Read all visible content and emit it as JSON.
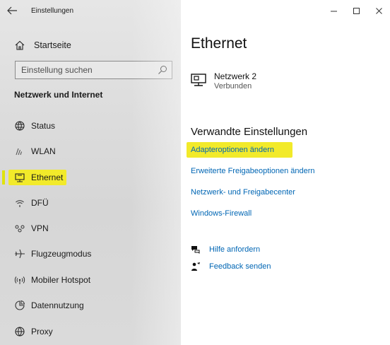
{
  "window": {
    "title": "Einstellungen"
  },
  "sidebar": {
    "home_label": "Startseite",
    "search_placeholder": "Einstellung suchen",
    "section_heading": "Netzwerk und Internet",
    "items": [
      {
        "label": "Status",
        "icon": "status-globe-icon"
      },
      {
        "label": "WLAN",
        "icon": "wifi-icon"
      },
      {
        "label": "Ethernet",
        "icon": "ethernet-icon",
        "selected": true
      },
      {
        "label": "DFÜ",
        "icon": "dialup-icon"
      },
      {
        "label": "VPN",
        "icon": "vpn-icon"
      },
      {
        "label": "Flugzeugmodus",
        "icon": "airplane-icon"
      },
      {
        "label": "Mobiler Hotspot",
        "icon": "hotspot-icon"
      },
      {
        "label": "Datennutzung",
        "icon": "data-usage-icon"
      },
      {
        "label": "Proxy",
        "icon": "proxy-globe-icon"
      }
    ]
  },
  "main": {
    "title": "Ethernet",
    "network": {
      "name": "Netzwerk 2",
      "status": "Verbunden"
    },
    "related_heading": "Verwandte Einstellungen",
    "links": [
      "Adapteroptionen ändern",
      "Erweiterte Freigabeoptionen ändern",
      "Netzwerk- und Freigabecenter",
      "Windows-Firewall"
    ],
    "help": {
      "get_help": "Hilfe anfordern",
      "feedback": "Feedback senden"
    }
  },
  "colors": {
    "accent_link": "#0066b4",
    "highlight": "#f2ea2a",
    "selection_bar": "#e0e30c"
  }
}
